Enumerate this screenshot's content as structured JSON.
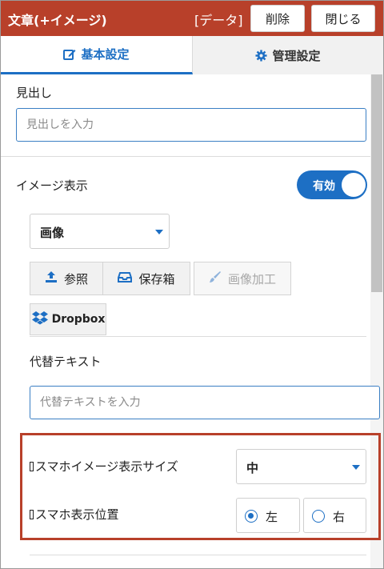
{
  "header": {
    "title": "文章(+イメージ)",
    "data_label": "[データ]",
    "delete_label": "削除",
    "close_label": "閉じる",
    "bg_color": "#b8402a"
  },
  "tabs": [
    {
      "label": "基本設定",
      "icon": "edit-icon",
      "active": true
    },
    {
      "label": "管理設定",
      "icon": "gear-icon",
      "active": false
    }
  ],
  "heading_field": {
    "label": "見出し",
    "placeholder": "見出しを入力",
    "value": ""
  },
  "image_display": {
    "label": "イメージ表示",
    "toggle_label": "有効",
    "enabled": true,
    "type_select": "画像"
  },
  "image_buttons": {
    "browse": "参照",
    "storage": "保存箱",
    "edit": "画像加工",
    "dropbox": "Dropbox"
  },
  "alt_text": {
    "label": "代替テキスト",
    "placeholder": "代替テキストを入力",
    "value": ""
  },
  "mobile": {
    "size_label": "スマホイメージ表示サイズ",
    "size_value": "中",
    "position_label": "スマホ表示位置",
    "position_options": [
      "左",
      "右"
    ],
    "position_selected": "左"
  },
  "accent_color": "#1d6fc4"
}
